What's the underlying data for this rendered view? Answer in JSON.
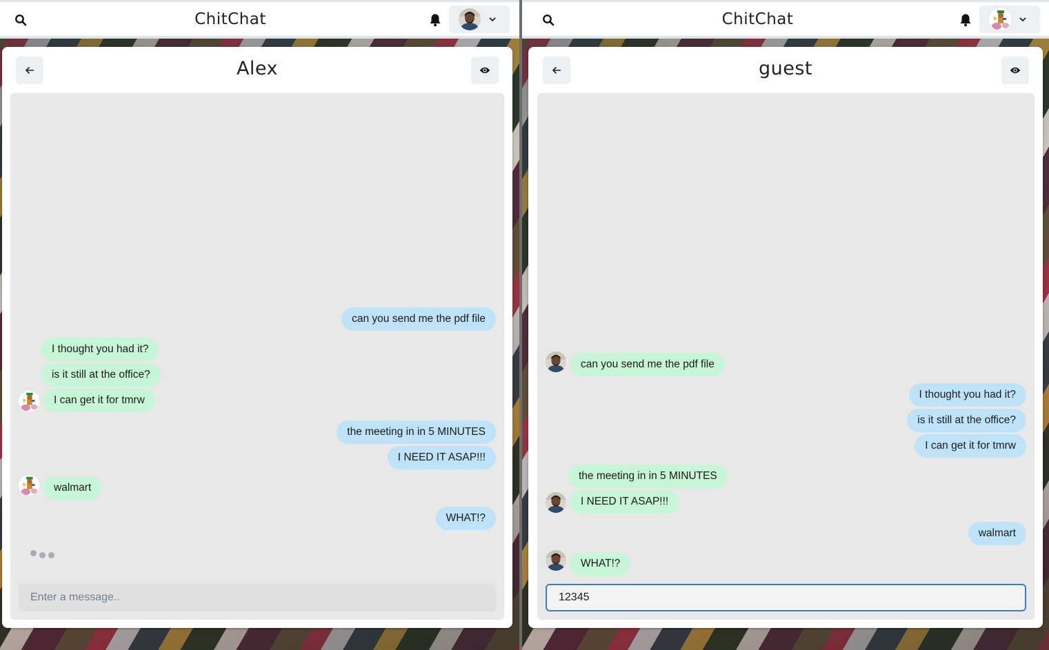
{
  "app": {
    "title": "ChitChat",
    "colors": {
      "sent_bubble": "#bee3f8",
      "received_bubble": "#c6f6d5",
      "input_focus": "#3a7dc2"
    }
  },
  "left": {
    "chat_title": "Alex",
    "input": {
      "placeholder": "Enter a message..",
      "value": ""
    },
    "typing_indicator": true,
    "messages": [
      {
        "text": "can you send me the pdf file",
        "side": "right"
      },
      {
        "text": "I thought you had it?",
        "side": "left"
      },
      {
        "text": "is it still at the office?",
        "side": "left"
      },
      {
        "text": "I can get it for tmrw",
        "side": "left",
        "avatar": true
      },
      {
        "text": "the meeting in in 5 MINUTES",
        "side": "right"
      },
      {
        "text": "I NEED IT ASAP!!!",
        "side": "right"
      },
      {
        "text": "walmart",
        "side": "left",
        "avatar": true
      },
      {
        "text": "WHAT!?",
        "side": "right"
      }
    ]
  },
  "right": {
    "chat_title": "guest",
    "input": {
      "placeholder": "Enter a message..",
      "value": "12345"
    },
    "messages": [
      {
        "text": "can you send me the pdf file",
        "side": "left",
        "avatar": true
      },
      {
        "text": "I thought you had it?",
        "side": "right"
      },
      {
        "text": "is it still at the office?",
        "side": "right"
      },
      {
        "text": "I can get it for tmrw",
        "side": "right"
      },
      {
        "text": "the meeting in in 5 MINUTES",
        "side": "left"
      },
      {
        "text": "I NEED IT ASAP!!!",
        "side": "left",
        "avatar": true
      },
      {
        "text": "walmart",
        "side": "right"
      },
      {
        "text": "WHAT!?",
        "side": "left",
        "avatar": true
      }
    ]
  },
  "icons": {
    "search": "search-icon",
    "bell": "bell-icon",
    "chevron": "chevron-down-icon",
    "back": "arrow-left-icon",
    "eye": "eye-icon"
  }
}
